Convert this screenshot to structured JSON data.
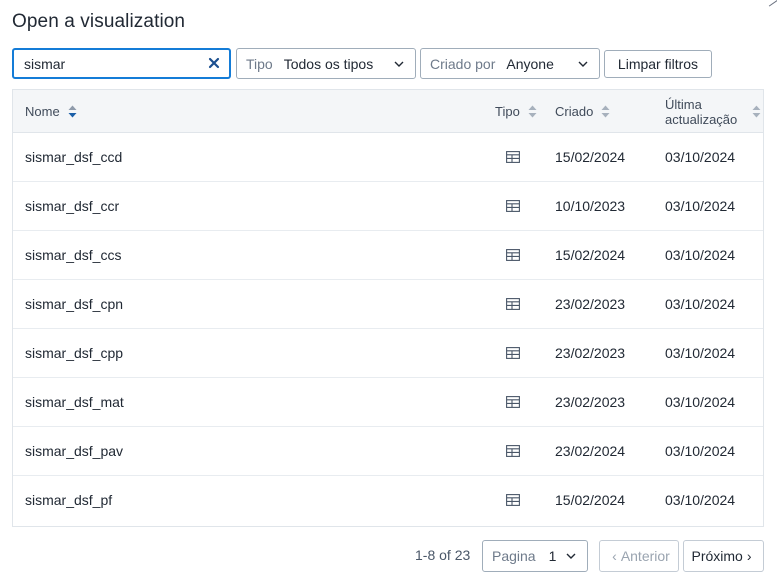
{
  "dialog": {
    "title": "Open a visualization"
  },
  "filters": {
    "search_value": "sismar",
    "type_prefix": "Tipo",
    "type_value": "Todos os tipos",
    "creator_prefix": "Criado por",
    "creator_value": "Anyone",
    "clear_filters_label": "Limpar filtros"
  },
  "table": {
    "headers": {
      "name": "Nome",
      "type": "Tipo",
      "created": "Criado",
      "updated": "Última actualização"
    },
    "rows": [
      {
        "name": "sismar_dsf_ccd",
        "type_icon": "table-icon",
        "created": "15/02/2024",
        "updated": "03/10/2024"
      },
      {
        "name": "sismar_dsf_ccr",
        "type_icon": "table-icon",
        "created": "10/10/2023",
        "updated": "03/10/2024"
      },
      {
        "name": "sismar_dsf_ccs",
        "type_icon": "table-icon",
        "created": "15/02/2024",
        "updated": "03/10/2024"
      },
      {
        "name": "sismar_dsf_cpn",
        "type_icon": "table-icon",
        "created": "23/02/2023",
        "updated": "03/10/2024"
      },
      {
        "name": "sismar_dsf_cpp",
        "type_icon": "table-icon",
        "created": "23/02/2023",
        "updated": "03/10/2024"
      },
      {
        "name": "sismar_dsf_mat",
        "type_icon": "table-icon",
        "created": "23/02/2023",
        "updated": "03/10/2024"
      },
      {
        "name": "sismar_dsf_pav",
        "type_icon": "table-icon",
        "created": "23/02/2024",
        "updated": "03/10/2024"
      },
      {
        "name": "sismar_dsf_pf",
        "type_icon": "table-icon",
        "created": "15/02/2024",
        "updated": "03/10/2024"
      }
    ]
  },
  "pagination": {
    "range_text": "1-8 of 23",
    "page_label": "Pagina",
    "page_value": "1",
    "prev_label": "Anterior",
    "next_label": "Próximo"
  },
  "colors": {
    "accent": "#147cd7",
    "sort_active": "#1b5fa8",
    "header_bg": "#f4f6f8"
  }
}
